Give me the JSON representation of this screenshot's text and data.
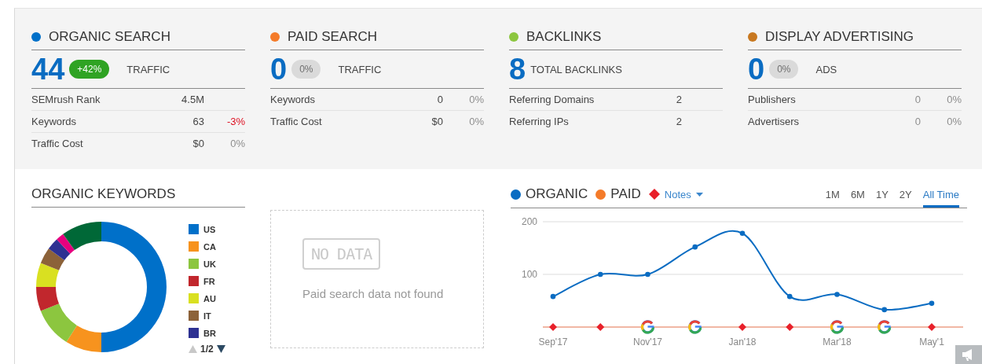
{
  "summary": [
    {
      "title": "ORGANIC SEARCH",
      "color": "#0070c9",
      "total": "44",
      "badge": {
        "text": "+42%",
        "kind": "positive"
      },
      "unit": "TRAFFIC",
      "rows": [
        {
          "label": "SEMrush Rank",
          "value": "4.5M",
          "muted": false
        },
        {
          "label": "Keywords",
          "value": "63",
          "muted": false,
          "change": "-3%",
          "kind": "negative"
        },
        {
          "label": "Traffic Cost",
          "value": "$0",
          "muted": false,
          "change": "0%",
          "kind": "neutral"
        }
      ]
    },
    {
      "title": "PAID SEARCH",
      "color": "#f47b2a",
      "total": "0",
      "badge": {
        "text": "0%",
        "kind": "neutral"
      },
      "unit": "TRAFFIC",
      "rows": [
        {
          "label": "Keywords",
          "value": "0",
          "muted": false,
          "change": "0%",
          "kind": "neutral"
        },
        {
          "label": "Traffic Cost",
          "value": "$0",
          "muted": false,
          "change": "0%",
          "kind": "neutral"
        }
      ]
    },
    {
      "title": "BACKLINKS",
      "color": "#8cc63f",
      "total": "8",
      "unit": "TOTAL BACKLINKS",
      "rows": [
        {
          "label": "Referring Domains",
          "value": "2",
          "muted": false
        },
        {
          "label": "Referring IPs",
          "value": "2",
          "muted": false
        }
      ]
    },
    {
      "title": "DISPLAY ADVERTISING",
      "color": "#c87820",
      "total": "0",
      "badge": {
        "text": "0%",
        "kind": "neutral"
      },
      "unit": "ADS",
      "rows": [
        {
          "label": "Publishers",
          "value": "0",
          "muted": true,
          "change": "0%",
          "kind": "neutral"
        },
        {
          "label": "Advertisers",
          "value": "0",
          "muted": true,
          "change": "0%",
          "kind": "neutral"
        }
      ]
    }
  ],
  "organic_keywords": {
    "title": "ORGANIC KEYWORDS",
    "legend": [
      {
        "label": "US",
        "color": "#0070c9"
      },
      {
        "label": "CA",
        "color": "#f7931e"
      },
      {
        "label": "UK",
        "color": "#8cc63f"
      },
      {
        "label": "FR",
        "color": "#c1272d"
      },
      {
        "label": "AU",
        "color": "#d9e021"
      },
      {
        "label": "IT",
        "color": "#8c6239"
      },
      {
        "label": "BR",
        "color": "#2e3192"
      }
    ],
    "pager": "1/2"
  },
  "paid_keywords": {
    "badge": "NO DATA",
    "message": "Paid search data not found"
  },
  "trend": {
    "legend": [
      {
        "kind": "series"
      },
      {
        "kind": "dot",
        "label": "PAID",
        "color": "#f47b2a"
      },
      {
        "kind": "dropdown",
        "label": "Notes",
        "color": "#e8202a"
      }
    ],
    "periods": [
      {
        "label": "1M",
        "selected": false
      },
      {
        "label": "6M",
        "selected": false
      },
      {
        "label": "1Y",
        "selected": false
      },
      {
        "label": "2Y",
        "selected": false
      },
      {
        "label": "All Time",
        "selected": true
      }
    ],
    "chart_data": {
      "type": "line",
      "x": [
        "Sep'17",
        null,
        "Nov'17",
        null,
        "Jan'18",
        null,
        "Mar'18",
        null,
        "May'1"
      ],
      "ylim": [
        0,
        200
      ],
      "yticks": [
        100,
        200
      ],
      "series": [
        {
          "name": "ORGANIC",
          "color": "#0a6cc2",
          "marker": "circle",
          "values": [
            58,
            100,
            100,
            152,
            178,
            58,
            62,
            33,
            45
          ]
        }
      ]
    },
    "notes": [
      {
        "kind": "note"
      },
      {
        "kind": "note"
      },
      {
        "kind": "google"
      },
      {
        "kind": "google"
      },
      {
        "kind": "note"
      },
      {
        "kind": "note"
      },
      {
        "kind": "google"
      },
      {
        "kind": "google"
      },
      {
        "kind": "note"
      }
    ]
  }
}
